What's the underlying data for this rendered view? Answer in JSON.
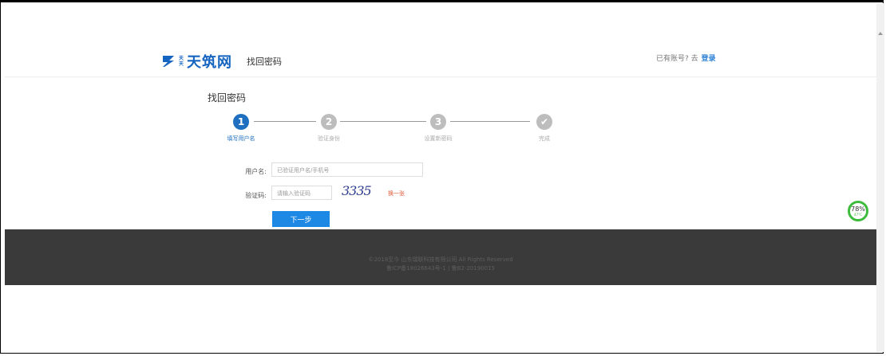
{
  "header": {
    "logo_small_1": "天",
    "logo_small_2": "天",
    "logo_text": "天筑网",
    "subtitle": "找回密码",
    "account_prompt": "已有账号? 去",
    "login_link": "登录"
  },
  "section_title": "找回密码",
  "steps": [
    {
      "number": "1",
      "label": "填写用户名",
      "state": "active"
    },
    {
      "number": "2",
      "label": "验证身份",
      "state": "inactive"
    },
    {
      "number": "3",
      "label": "设置新密码",
      "state": "inactive"
    },
    {
      "number": "✔",
      "label": "完成",
      "state": "inactive"
    }
  ],
  "form": {
    "username_label": "用户名:",
    "username_placeholder": "已验证用户名/手机号",
    "captcha_label": "验证码:",
    "captcha_placeholder": "请输入验证码",
    "captcha_image_text": "3335",
    "refresh_label": "换一张",
    "next_button": "下一步"
  },
  "footer": {
    "copyright": "©2018至今 山东瑞联科技有限公司 All Rights Reserved",
    "icp": "鲁ICP备18026643号-1 | 鲁B2-20190015"
  },
  "temp_widget": {
    "percent": "78%",
    "temperature": "47°C"
  },
  "colors": {
    "brand": "#1565c0",
    "primary_button": "#1e88e5",
    "footer_bg": "#3a3a3a",
    "refresh": "#e05a3a",
    "widget_ring": "#3dbb3d"
  }
}
